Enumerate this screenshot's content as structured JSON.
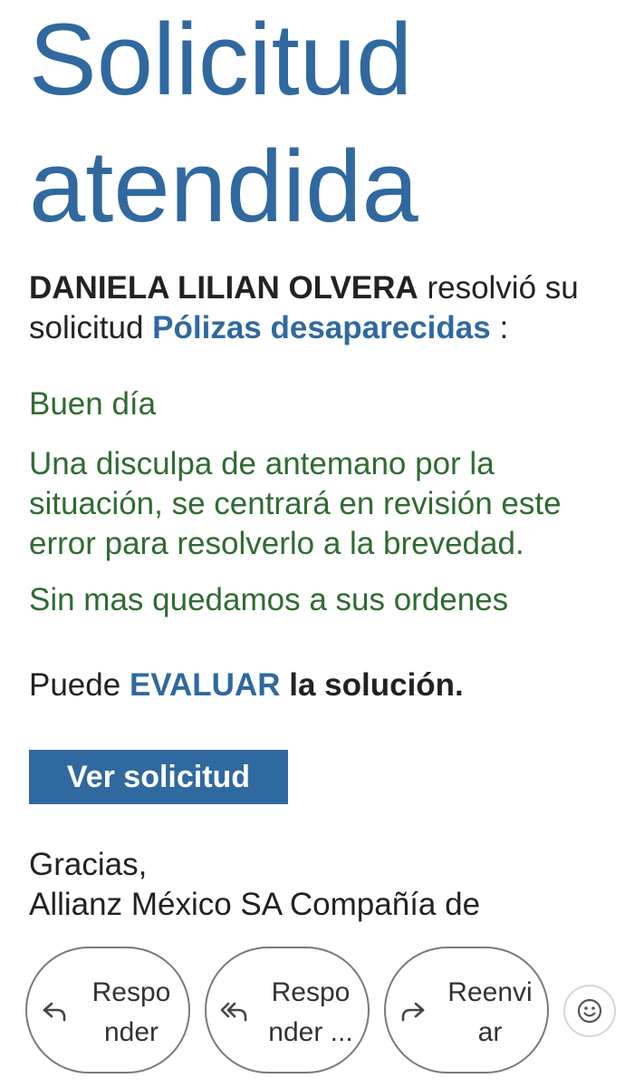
{
  "email": {
    "title_line1": "Solicitud",
    "title_line2": "atendida",
    "intro": {
      "agent_name": "DANIELA LILIAN OLVERA",
      "text1": " resolvió su solicitud ",
      "subject": "Pólizas desaparecidas",
      "text2": " :"
    },
    "message": {
      "greeting": "Buen día",
      "body": "Una disculpa de antemano por la situación, se centrará en revisión este error para resolverlo a la brevedad.",
      "closing": "Sin mas quedamos a sus ordenes"
    },
    "evaluate": {
      "prefix": "Puede ",
      "link": "EVALUAR",
      "suffix": " la solución."
    },
    "view_button": "Ver solicitud",
    "signoff": {
      "thanks": "Gracias,",
      "company": "Allianz México SA Compañía de"
    }
  },
  "actions": {
    "reply": {
      "line1": "Respo",
      "line2": "nder",
      "icon": "reply-icon"
    },
    "reply_all": {
      "line1": "Respo",
      "line2": "nder ...",
      "icon": "reply-all-icon"
    },
    "forward": {
      "line1": "Reenvi",
      "line2": "ar",
      "icon": "forward-icon"
    },
    "emoji": {
      "icon": "emoji-icon"
    }
  },
  "colors": {
    "accent_blue": "#30699f",
    "message_green": "#2f6b33",
    "text_dark": "#222222"
  }
}
